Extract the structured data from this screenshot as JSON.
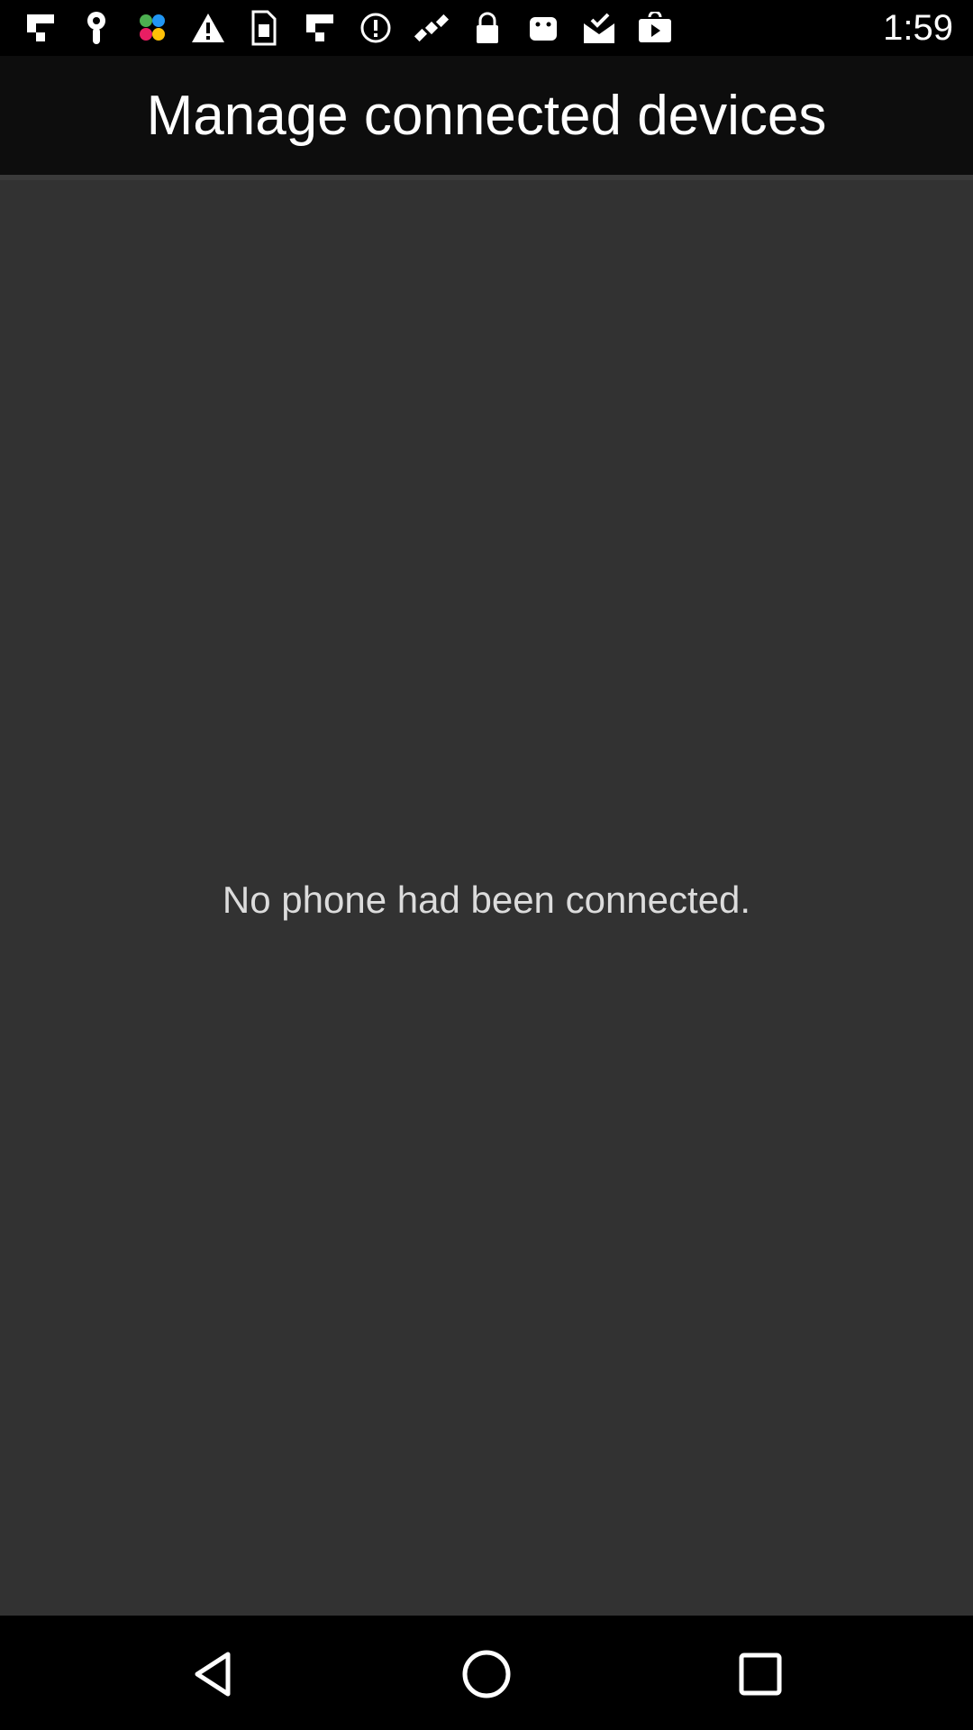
{
  "status_bar": {
    "icons": [
      "flipboard-icon",
      "maps-pin-icon",
      "photos-pinwheel-icon",
      "warning-icon",
      "sim-card-icon",
      "flipboard-icon",
      "info-circle-icon",
      "fake-gps-satellite-icon",
      "lock-icon",
      "android-icon",
      "mail-check-icon",
      "play-store-icon"
    ],
    "time": "1:59"
  },
  "header": {
    "title": "Manage connected devices"
  },
  "main": {
    "empty_message": "No phone had been connected."
  },
  "nav_bar": {
    "buttons": [
      "back-icon",
      "home-icon",
      "recents-icon"
    ]
  },
  "colors": {
    "title_bar_bg": "#0d0d0d",
    "content_bg": "#323232",
    "text_primary": "#ffffff"
  }
}
